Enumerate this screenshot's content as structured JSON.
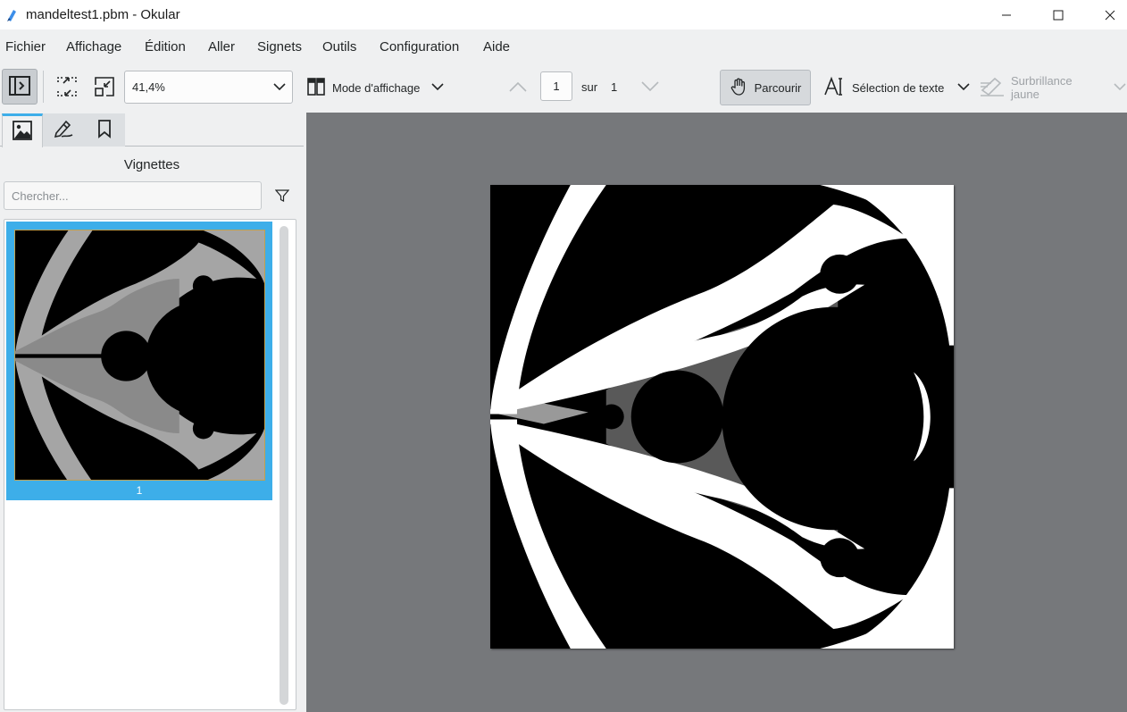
{
  "window": {
    "title": "mandeltest1.pbm  - Okular"
  },
  "menubar": {
    "items": [
      "Fichier",
      "Affichage",
      "Édition",
      "Aller",
      "Signets",
      "Outils",
      "Configuration",
      "Aide"
    ]
  },
  "toolbar": {
    "zoom_value": "41,4%",
    "view_mode_label": "Mode d'affichage",
    "page_current": "1",
    "page_of_label": "sur",
    "page_total": "1",
    "browse_label": "Parcourir",
    "text_select_label": "Sélection de texte",
    "highlight_label": "Surbrillance jaune"
  },
  "sidebar": {
    "title": "Vignettes",
    "search_placeholder": "Chercher...",
    "thumbnails": [
      {
        "label": "1",
        "selected": true
      }
    ]
  },
  "colors": {
    "accent": "#3daee9",
    "document_background": "#76787b",
    "chrome_background": "#eff0f1"
  },
  "icons": {
    "app": "okular-icon",
    "sidebar_toggle": "sidebar-toggle-icon",
    "fit_width": "fit-width-icon",
    "fit_page": "fit-page-icon",
    "view_mode": "view-mode-icon",
    "page_up": "chevron-up-icon",
    "page_down": "chevron-down-icon",
    "browse": "hand-icon",
    "text_select": "text-select-icon",
    "highlight": "highlighter-icon",
    "filter": "filter-icon"
  }
}
